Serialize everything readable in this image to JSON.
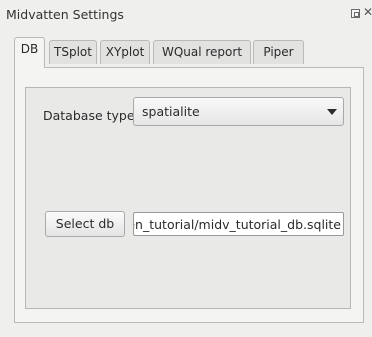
{
  "window": {
    "title": "Midvatten Settings"
  },
  "tabs": [
    {
      "label": "DB",
      "active": true
    },
    {
      "label": "TSplot",
      "active": false
    },
    {
      "label": "XYplot",
      "active": false
    },
    {
      "label": "WQual report",
      "active": false
    },
    {
      "label": "Piper",
      "active": false
    }
  ],
  "db_tab": {
    "database_type_label": "Database type",
    "database_type_value": "spatialite",
    "select_db_label": "Select db",
    "db_path_value": "C:/midvatten_tutorial/midv_tutorial_db.sqlite",
    "db_path_visible": "atten_tutorial/midv_tutorial_db.sqlite"
  },
  "icons": {
    "float": "float-icon",
    "close": "close-icon",
    "dropdown": "chevron-down-icon"
  }
}
